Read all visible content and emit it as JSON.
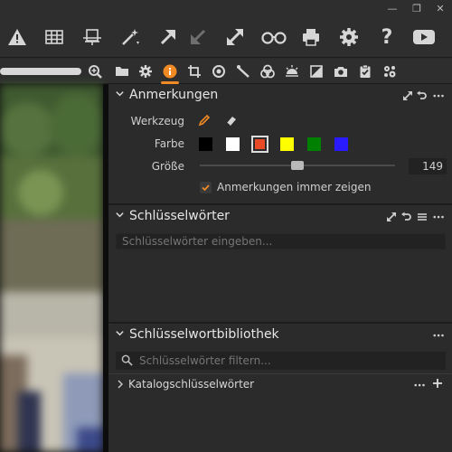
{
  "window": {
    "minimize": "—",
    "restore": "❐",
    "close": "✕"
  },
  "toolbar": {
    "icons": [
      "warning-icon",
      "grid-icon",
      "overlay-icon",
      "magic-wand-icon",
      "arrow-up-right-icon",
      "arrow-down-left-icon",
      "fullscreen-icon",
      "proof-glasses-icon",
      "print-icon",
      "settings-icon",
      "help-icon",
      "video-icon"
    ],
    "help_label": "?"
  },
  "tool_tabs": {
    "icons": [
      "folder-icon",
      "gear-tab-icon",
      "info-icon",
      "crop-icon",
      "circle-icon",
      "ruler-icon",
      "color-icon",
      "exposure-icon",
      "contrast-icon",
      "camera-icon",
      "clipboard-icon",
      "batch-icon"
    ],
    "active_index": 2,
    "accent": "#f08a24"
  },
  "annotations": {
    "title": "Anmerkungen",
    "tool_label": "Werkzeug",
    "color_label": "Farbe",
    "size_label": "Größe",
    "size_value": "149",
    "size_fraction": 0.5,
    "colors": [
      "#000000",
      "#ffffff",
      "#e84a27",
      "#ffff00",
      "#008000",
      "#2a1bff"
    ],
    "selected_color_index": 2,
    "always_show_label": "Anmerkungen immer zeigen",
    "always_show_checked": true
  },
  "keywords": {
    "title": "Schlüsselwörter",
    "placeholder": "Schlüsselwörter eingeben..."
  },
  "keyword_library": {
    "title": "Schlüsselwortbibliothek",
    "search_placeholder": "Schlüsselwörter filtern...",
    "catalog_label": "Katalogschlüsselwörter"
  },
  "colors": {
    "accent": "#f08a24",
    "panel_bg": "#2b2b2b",
    "toolbar_bg": "#2e2e2e"
  }
}
